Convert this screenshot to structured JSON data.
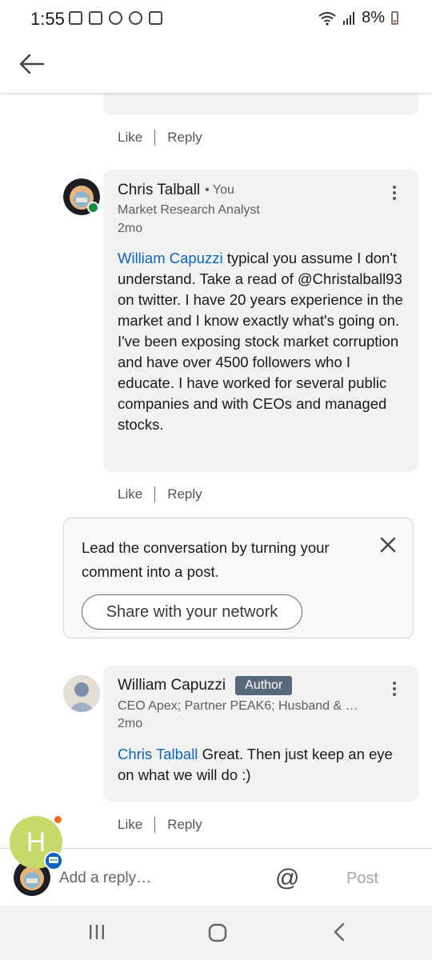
{
  "status": {
    "time": "1:55",
    "battery": "8%"
  },
  "comments": [
    {
      "author": "Chris Talball",
      "you_tag": "• You",
      "headline": "Market Research Analyst",
      "time": "2mo",
      "mention": "William Capuzzi",
      "text": " typical you assume I don't understand. Take a read of @Christalball93 on twitter. I have 20 years experience in the market and I know exactly what's going on. I've been exposing stock market corruption and have over 4500 followers who I educate. I have worked for several public companies and with CEOs and managed stocks."
    },
    {
      "author": "William Capuzzi",
      "badge": "Author",
      "headline": "CEO Apex; Partner PEAK6; Husband & …",
      "time": "2mo",
      "mention": "Chris Talball",
      "text": " Great.  Then just keep an eye on what we will do :)"
    }
  ],
  "actions": {
    "like": "Like",
    "reply": "Reply"
  },
  "prompt": {
    "text": "Lead the conversation by turning your comment into a post.",
    "button": "Share with your network"
  },
  "fab": {
    "letter": "H"
  },
  "composer": {
    "placeholder": "Add a reply…",
    "at": "@",
    "post": "Post"
  },
  "colors": {
    "link": "#0a66c2",
    "badge": "#56687a",
    "fab": "#c8d96a"
  }
}
